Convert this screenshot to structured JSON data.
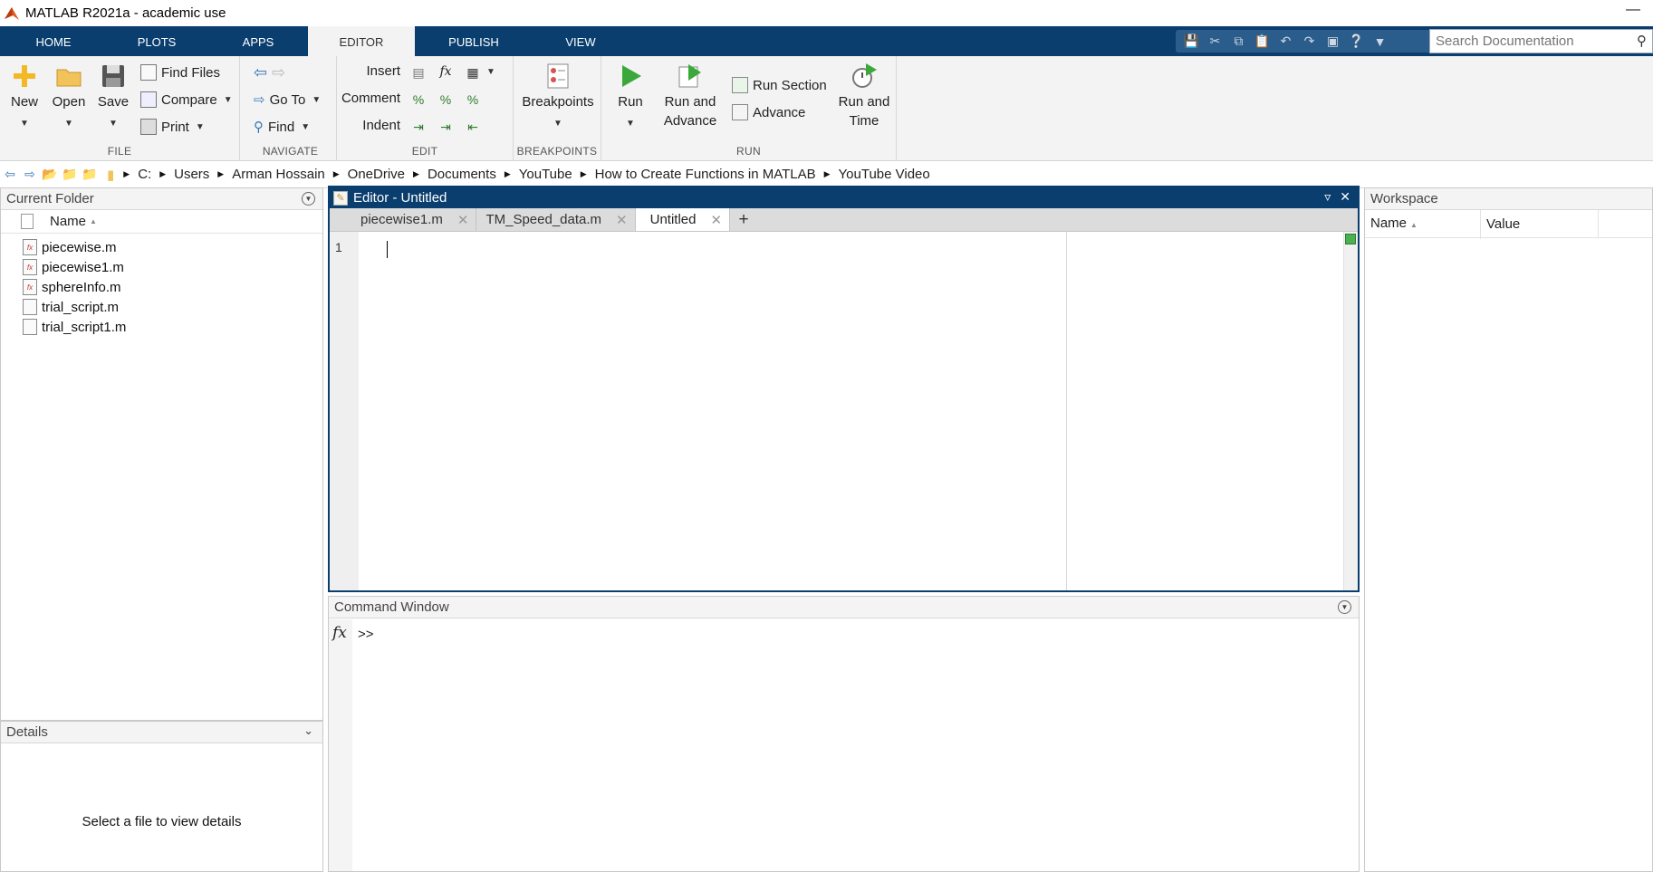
{
  "window": {
    "title": "MATLAB R2021a - academic use"
  },
  "ribbon": {
    "tabs": [
      "HOME",
      "PLOTS",
      "APPS",
      "EDITOR",
      "PUBLISH",
      "VIEW"
    ],
    "active_tab": "EDITOR",
    "search": {
      "placeholder": "Search Documentation"
    }
  },
  "toolstrip": {
    "file": {
      "caption": "FILE",
      "new": "New",
      "open": "Open",
      "save": "Save",
      "find_files": "Find Files",
      "compare": "Compare",
      "print": "Print"
    },
    "navigate": {
      "caption": "NAVIGATE",
      "go_to": "Go To",
      "find": "Find"
    },
    "edit": {
      "caption": "EDIT",
      "insert": "Insert",
      "comment": "Comment",
      "indent": "Indent"
    },
    "breakpoints": {
      "caption": "BREAKPOINTS",
      "breakpoints": "Breakpoints"
    },
    "run": {
      "caption": "RUN",
      "run": "Run",
      "run_and_advance_1": "Run and",
      "run_and_advance_2": "Advance",
      "run_section": "Run Section",
      "advance": "Advance",
      "run_and_time_1": "Run and",
      "run_and_time_2": "Time"
    }
  },
  "address": {
    "crumbs": [
      "C:",
      "Users",
      "Arman Hossain",
      "OneDrive",
      "Documents",
      "YouTube",
      "How to Create Functions in MATLAB",
      "YouTube Video"
    ]
  },
  "current_folder": {
    "title": "Current Folder",
    "name_header": "Name",
    "sort_indicator": "▲",
    "files": [
      {
        "name": "piecewise.m",
        "kind": "function"
      },
      {
        "name": "piecewise1.m",
        "kind": "function"
      },
      {
        "name": "sphereInfo.m",
        "kind": "function"
      },
      {
        "name": "trial_script.m",
        "kind": "script"
      },
      {
        "name": "trial_script1.m",
        "kind": "script"
      }
    ]
  },
  "details": {
    "title": "Details",
    "empty_message": "Select a file to view details"
  },
  "editor": {
    "title": "Editor - Untitled",
    "tabs": [
      "piecewise1.m",
      "TM_Speed_data.m",
      "Untitled"
    ],
    "active_tab": "Untitled",
    "line_numbers": [
      "1"
    ]
  },
  "command_window": {
    "title": "Command Window",
    "fx": "fx",
    "prompt": ">>"
  },
  "workspace": {
    "title": "Workspace",
    "name_header": "Name",
    "value_header": "Value",
    "sort_indicator": "▲"
  },
  "colors": {
    "ribbon_bg": "#0a3e6e",
    "toolstrip_bg": "#f3f3f3",
    "run_green": "#3aa83a"
  }
}
